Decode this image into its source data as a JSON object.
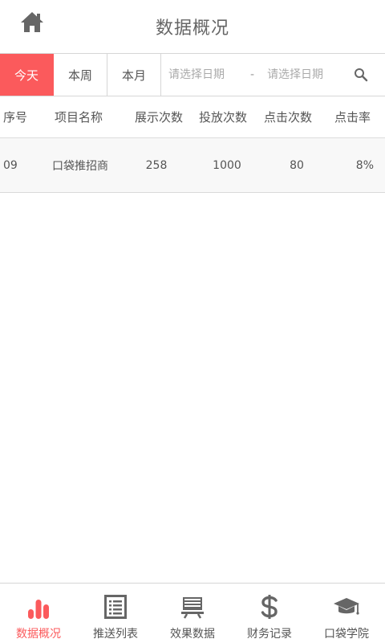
{
  "header": {
    "title": "数据概况",
    "home_icon": "home-icon"
  },
  "filter": {
    "segments": [
      {
        "label": "今天",
        "active": true
      },
      {
        "label": "本周",
        "active": false
      },
      {
        "label": "本月",
        "active": false
      }
    ],
    "start_placeholder": "请选择日期",
    "separator": "-",
    "end_placeholder": "请选择日期",
    "search_icon": "search-icon"
  },
  "table": {
    "columns": [
      "序号",
      "项目名称",
      "展示次数",
      "投放次数",
      "点击次数",
      "点击率"
    ],
    "rows": [
      {
        "seq": "09",
        "name": "口袋推招商",
        "shows": "258",
        "casts": "1000",
        "clicks": "80",
        "rate": "8%"
      }
    ]
  },
  "nav": {
    "items": [
      {
        "label": "数据概况",
        "icon": "bar-chart-icon",
        "active": true
      },
      {
        "label": "推送列表",
        "icon": "list-icon",
        "active": false
      },
      {
        "label": "效果数据",
        "icon": "monitor-icon",
        "active": false
      },
      {
        "label": "财务记录",
        "icon": "dollar-icon",
        "active": false
      },
      {
        "label": "口袋学院",
        "icon": "graduation-cap-icon",
        "active": false
      }
    ]
  },
  "colors": {
    "accent": "#fb5a5c",
    "text": "#555555",
    "icon": "#666666",
    "border": "#d6d6d6",
    "row_bg": "#f8f8f8"
  }
}
